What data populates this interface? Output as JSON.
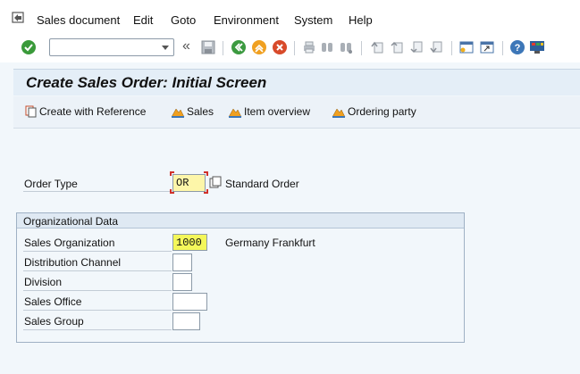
{
  "menu": {
    "items": [
      "Sales document",
      "Edit",
      "Goto",
      "Environment",
      "System",
      "Help"
    ]
  },
  "toolbar": {
    "command_field_value": "",
    "buttons": [
      "enter-icon",
      "save-icon",
      "back-icon",
      "exit-icon",
      "cancel-icon",
      "print-icon",
      "find-icon",
      "find-next-icon",
      "first-page-icon",
      "prev-page-icon",
      "next-page-icon",
      "last-page-icon",
      "create-session-icon",
      "shortcut-icon",
      "help-icon",
      "customize-layout-icon"
    ]
  },
  "title": "Create Sales Order: Initial Screen",
  "app_toolbar": {
    "create_with_reference": "Create with Reference",
    "sales": "Sales",
    "item_overview": "Item overview",
    "ordering_party": "Ordering party"
  },
  "order_type": {
    "label": "Order Type",
    "value": "OR",
    "description": "Standard Order"
  },
  "org_data": {
    "title": "Organizational Data",
    "sales_org_label": "Sales Organization",
    "sales_org_value": "1000",
    "sales_org_description": "Germany Frankfurt",
    "dist_channel_label": "Distribution Channel",
    "dist_channel_value": "",
    "division_label": "Division",
    "division_value": "",
    "sales_office_label": "Sales Office",
    "sales_office_value": "",
    "sales_group_label": "Sales Group",
    "sales_group_value": ""
  },
  "colors": {
    "title_bg": "#e4eef7",
    "highlight_yellow": "#f4f75a",
    "required_marker": "#d0312a"
  }
}
